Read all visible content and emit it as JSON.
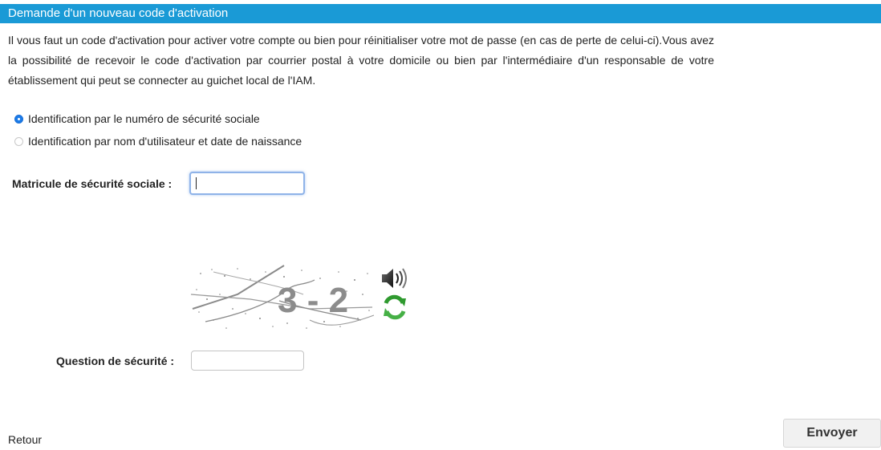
{
  "header": {
    "title": "Demande d'un nouveau code d'activation"
  },
  "intro": {
    "text": "Il vous faut un code d'activation pour activer votre compte ou bien pour réinitialiser votre mot de passe (en cas de perte de celui-ci).Vous avez la possibilité de recevoir le code d'activation par courrier postal à votre domicile ou bien par l'intermédiaire d'un responsable de votre établissement qui peut se connecter au guichet local de l'IAM."
  },
  "options": [
    {
      "label": "Identification par le numéro de sécurité sociale",
      "selected": true
    },
    {
      "label": "Identification par nom d'utilisateur et date de naissance",
      "selected": false
    }
  ],
  "form": {
    "matricule_label": "Matricule de sécurité sociale :",
    "matricule_value": "",
    "question_label": "Question de sécurité :",
    "question_value": ""
  },
  "captcha": {
    "text": "3 - 2"
  },
  "icons": {
    "audio": "speaker-icon",
    "refresh": "refresh-icon"
  },
  "colors": {
    "header_bg": "#1a9ad6",
    "radio_selected": "#1b7be8",
    "refresh_green": "#3aa33a"
  },
  "footer": {
    "back_label": "Retour",
    "submit_label": "Envoyer"
  }
}
